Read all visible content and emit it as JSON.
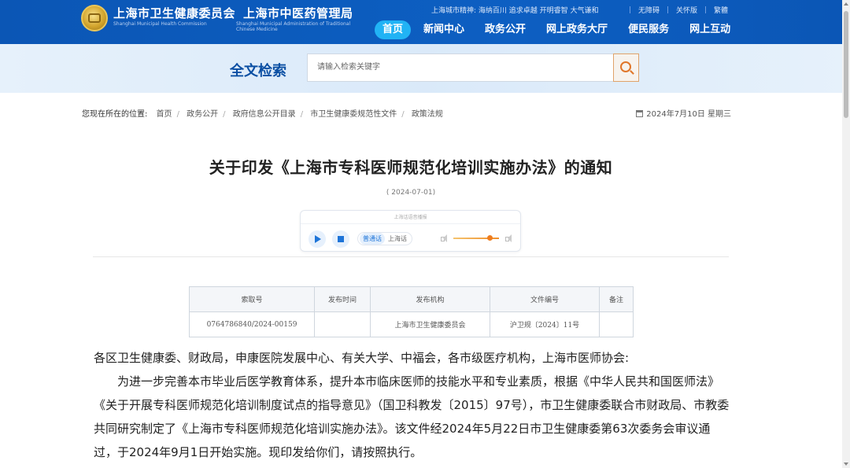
{
  "header": {
    "org_cn_1": "上海市卫生健康委员会",
    "org_cn_2": "上海市中医药管理局",
    "org_en_1": "Shanghai Municipal Health Commission",
    "org_en_2": "Shanghai Municipal Administration of Traditional Chinese Medicine",
    "city_spirit": "上海城市精神: 海纳百川 追求卓越 开明睿智 大气谦和",
    "util_links": [
      "无障碍",
      "关怀版",
      "繁體"
    ],
    "nav": [
      "首页",
      "新闻中心",
      "政务公开",
      "网上政务大厅",
      "便民服务",
      "网上互动"
    ],
    "colors": {
      "header_bg": "#0d5fc2",
      "nav_active": "#21b3f5"
    }
  },
  "search": {
    "title": "全文检索",
    "placeholder": "请输入检索关键字",
    "button_icon": "search-icon"
  },
  "breadcrumb": {
    "label": "您现在所在的位置:",
    "items": [
      "首页",
      "政务公开",
      "政府信息公开目录",
      "市卫生健康委规范性文件",
      "政策法规"
    ]
  },
  "date_line": "2024年7月10日 星期三",
  "article": {
    "title": "关于印发《上海市专科医师规范化培训实施办法》的通知",
    "date": "( 2024-07-01)"
  },
  "player": {
    "header": "上海话语音播报",
    "lang_selected": "普通话",
    "lang_other": "上海话",
    "volume": 0.75
  },
  "info_table": {
    "headers": [
      "索取号",
      "发布时间",
      "发布机构",
      "文件编号",
      "备注"
    ],
    "row": [
      "0764786840/2024-00159",
      "",
      "上海市卫生健康委员会",
      "沪卫规〔2024〕11号",
      ""
    ]
  },
  "body": {
    "salutation": "各区卫生健康委、财政局，申康医院发展中心、有关大学、中福会，各市级医疗机构，上海市医师协会:",
    "paragraph": "为进一步完善本市毕业后医学教育体系，提升本市临床医师的技能水平和专业素质，根据《中华人民共和国医师法》《关于开展专科医师规范化培训制度试点的指导意见》（国卫科教发〔2015〕97号），市卫生健康委联合市财政局、市教委共同研究制定了《上海市专科医师规范化培训实施办法》。该文件经2024年5月22日市卫生健康委第63次委务会审议通过，于2024年9月1日开始实施。现印发给你们，请按照执行。"
  }
}
